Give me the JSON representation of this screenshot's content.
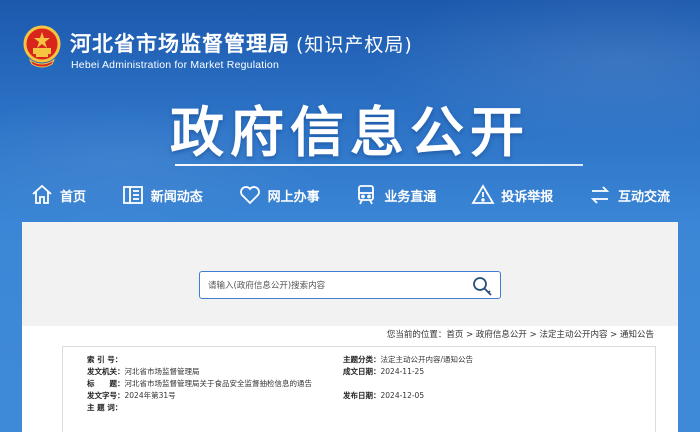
{
  "header": {
    "title": "河北省市场监督管理局",
    "title_paren": "(知识产权局)",
    "subtitle_en": "Hebei Administration for Market Regulation",
    "hero": "政府信息公开"
  },
  "nav": [
    {
      "label": "首页",
      "icon": "home-icon"
    },
    {
      "label": "新闻动态",
      "icon": "news-icon"
    },
    {
      "label": "网上办事",
      "icon": "heart-hand-icon"
    },
    {
      "label": "业务直通",
      "icon": "train-icon"
    },
    {
      "label": "投诉举报",
      "icon": "warning-icon"
    },
    {
      "label": "互动交流",
      "icon": "exchange-icon"
    }
  ],
  "search": {
    "placeholder": "请输入(政府信息公开)搜索内容",
    "icon": "search-icon"
  },
  "breadcrumb": "您当前的位置：首页 > 政府信息公开 > 法定主动公开内容 > 通知公告",
  "meta": {
    "index_label": "索 引 号：",
    "index_value": "",
    "org_label": "发文机关：",
    "org_value": "河北省市场监督管理局",
    "title_label": "标　　题：",
    "title_value": "河北省市场监督管理局关于食品安全监督抽检信息的通告",
    "docno_label": "发文字号：",
    "docno_value": "2024年第31号",
    "subject_label": "主 题 词：",
    "subject_value": "",
    "category_label": "主题分类：",
    "category_value": "法定主动公开内容/通知公告",
    "created_label": "成文日期：",
    "created_value": "2024-11-25",
    "published_label": "发布日期：",
    "published_value": "2024-12-05"
  },
  "colors": {
    "primary_blue": "#2a6fc3",
    "search_border": "#3e7fd1"
  }
}
